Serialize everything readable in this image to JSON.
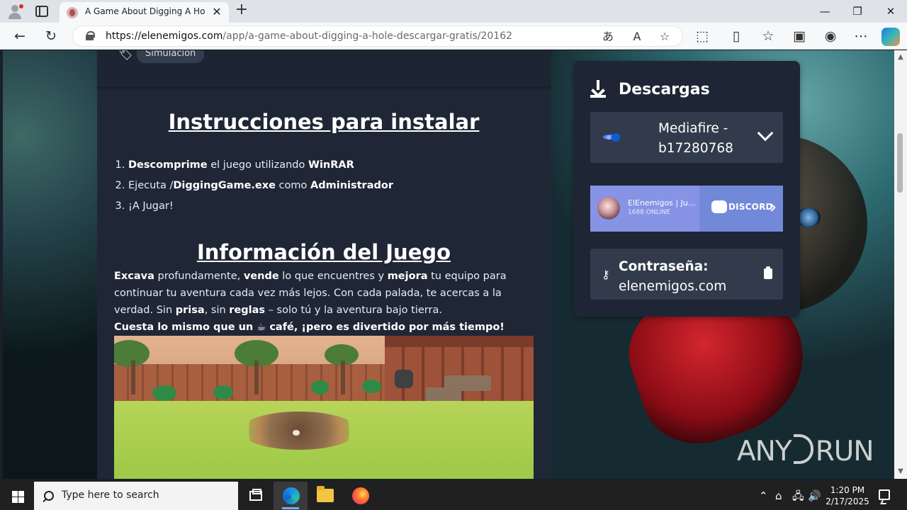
{
  "browser": {
    "tab_title": "A Game About Digging A Hole | I",
    "url_host": "https://elenemigos.com",
    "url_path": "/app/a-game-about-digging-a-hole-descargar-gratis/20162",
    "close_tab": "✕",
    "new_tab": "+",
    "window": {
      "minimize": "—",
      "restore": "❐",
      "close": "✕"
    },
    "nav": {
      "back": "←",
      "reload": "↻"
    },
    "address_icons": {
      "read_aloud": "A",
      "favorite": "☆"
    },
    "toolbar_icons": [
      "extensions-icon",
      "split-screen-icon",
      "favorites-icon",
      "collections-icon",
      "performance-icon",
      "more-icon"
    ]
  },
  "page": {
    "tag": "Simulación",
    "instructions_title": "Instrucciones para instalar ",
    "instructions": [
      {
        "strong1": "Descomprime",
        "text1": " el juego utilizando ",
        "strong2": "WinRAR"
      },
      {
        "text1": "Ejecuta /",
        "strong1": "DiggingGame.exe",
        "text2": " como ",
        "strong2": "Administrador"
      },
      {
        "text1": "¡A Jugar!"
      }
    ],
    "info_title": "Información del Juego",
    "info": {
      "strong1": "Excava",
      "text1": " profundamente, ",
      "strong2": "vende",
      "text2": " lo que encuentres y ",
      "strong3": "mejora",
      "text3": " tu equipo para continuar tu aventura cada vez más lejos. Con cada palada, te acercas a la verdad. Sin ",
      "strong4": "prisa",
      "text4": ", sin ",
      "strong5": "reglas",
      "text5": " – solo tú y la aventura bajo tierra."
    },
    "cost": "Cuesta lo mismo que un ☕ café, ¡pero es divertido por más tiempo!"
  },
  "sidebar": {
    "downloads_title": "Descargas",
    "mirror_label": "Mediafire - b17280768",
    "discord": {
      "server": "ElEnemigos | Ju...",
      "online": "1688 ONLINE",
      "brand": "DISCORD"
    },
    "password_label": "Contraseña:",
    "password_value": "elenemigos.com"
  },
  "watermark": {
    "left": "ANY",
    "right": "RUN"
  },
  "taskbar": {
    "search_placeholder": "Type here to search",
    "time": "1:20 PM",
    "date": "2/17/2025",
    "tray_symbols": {
      "chevron": "⌃",
      "network": "🖧",
      "volume": "🔊"
    }
  },
  "colors": {
    "page_background": "#1f2736",
    "accent_discord": "#7289da",
    "panel": "#323b4b",
    "taskbar": "#202020"
  }
}
